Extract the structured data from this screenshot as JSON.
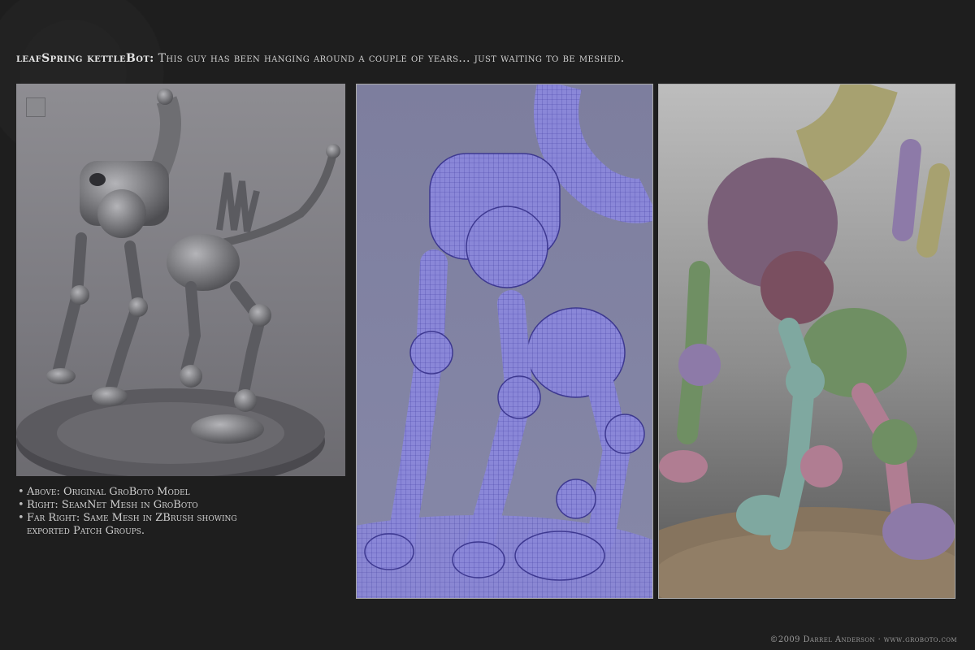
{
  "headline": {
    "title": "leafSpring kettleBot:",
    "text": "This guy has been hanging around a couple of years... just waiting to be meshed."
  },
  "bullets": [
    "Above: Original GroBoto Model",
    "Right: SeamNet Mesh in GroBoto",
    "Far Right: Same Mesh in ZBrush showing",
    "exported Patch Groups."
  ],
  "copyright": "©2009 Darrel Anderson · www.groboto.com",
  "colors": {
    "background": "#1e1e1e",
    "grey_model": "#8a8a8e",
    "wire_mesh": "#6a66c8",
    "patch_groups": [
      "#7a5f78",
      "#6f8f63",
      "#b07d92",
      "#7fa8a0",
      "#a7a170",
      "#8d7aa8"
    ]
  },
  "images": {
    "left": "grey-render-robot",
    "middle": "wireframe-mesh-robot",
    "right": "patch-group-robot"
  }
}
